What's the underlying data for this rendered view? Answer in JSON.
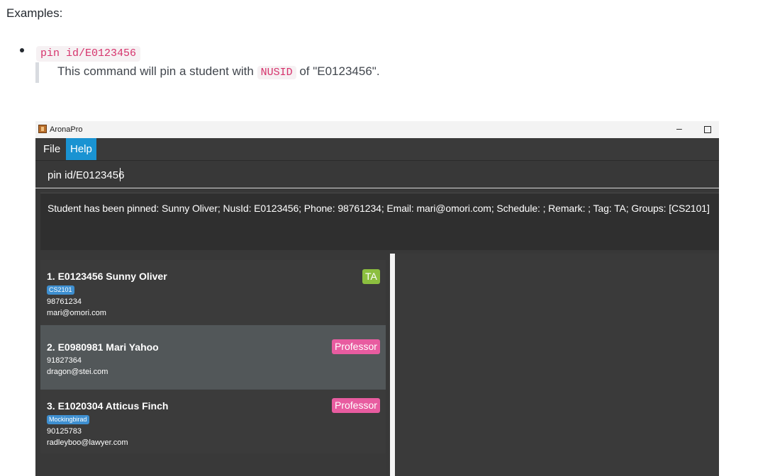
{
  "doc": {
    "examples_heading": "Examples:",
    "example_command": "pin id/E0123456",
    "quote_prefix": "This command will pin a student with",
    "quote_code": "NUSID",
    "quote_suffix": "of \"E0123456\"."
  },
  "window": {
    "title": "AronaPro",
    "minimize_glyph": "–"
  },
  "menu": {
    "file": "File",
    "help": "Help"
  },
  "command": {
    "value": "pin id/E0123456"
  },
  "result": {
    "text": "Student has been pinned: Sunny Oliver; NusId: E0123456; Phone: 98761234; Email: mari@omori.com; Schedule: ; Remark: ; Tag: TA; Groups: [CS2101]"
  },
  "persons": [
    {
      "title": "1.  E0123456  Sunny Oliver",
      "group": "CS2101",
      "phone": "98761234",
      "email": "mari@omori.com",
      "tag": "TA"
    },
    {
      "title": "2.  E0980981  Mari Yahoo",
      "group": "",
      "phone": "91827364",
      "email": "dragon@stei.com",
      "tag": "Professor"
    },
    {
      "title": "3.  E1020304  Atticus Finch",
      "group": "Mockingbirad",
      "phone": "90125783",
      "email": "radleyboo@lawyer.com",
      "tag": "Professor"
    }
  ],
  "colors": {
    "menu_active": "#1a93d2",
    "tag_ta": "#8cbf3f",
    "tag_professor": "#e85ca0",
    "group_chip": "#3e8fd0",
    "selected_card": "#525759"
  }
}
